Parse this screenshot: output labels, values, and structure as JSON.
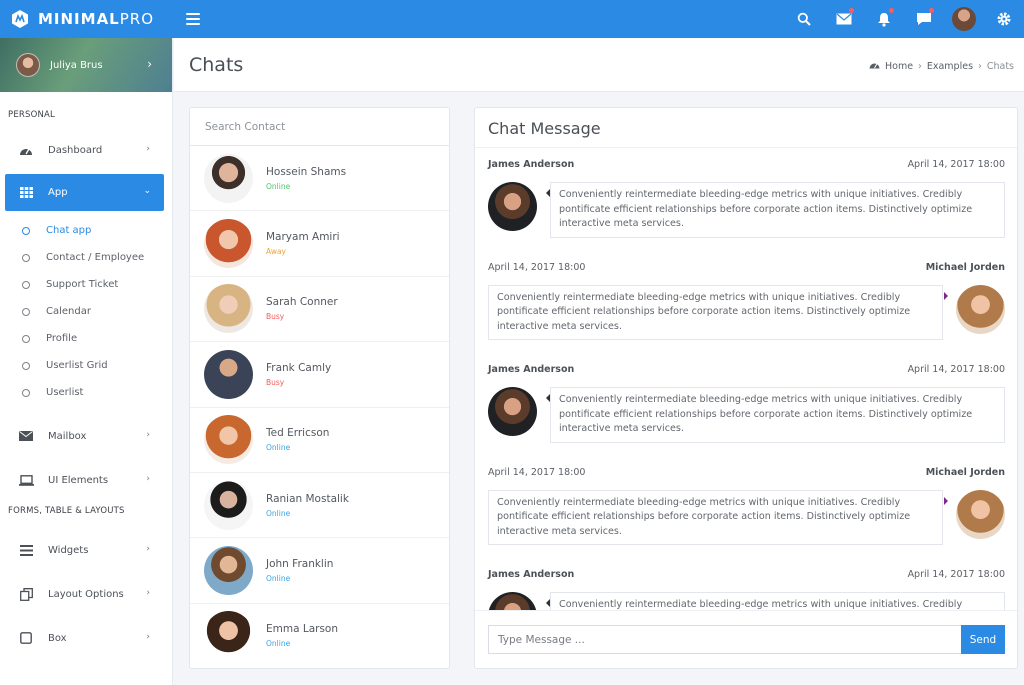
{
  "brand": {
    "name": "MINIMAL",
    "suffix": "PRO"
  },
  "topbar": {
    "icons": [
      "search-icon",
      "mail-icon",
      "bell-icon",
      "chat-icon",
      "avatar",
      "gear-icon"
    ],
    "accent": "#2b8ae3",
    "notification_dot": "#ff5b5b"
  },
  "sidebar": {
    "user": {
      "name": "Juliya Brus"
    },
    "section_personal": "PERSONAL",
    "section_forms": "FORMS, TABLE & LAYOUTS",
    "items": {
      "dashboard": "Dashboard",
      "app": "App",
      "mailbox": "Mailbox",
      "ui_elements": "UI Elements",
      "widgets": "Widgets",
      "layout_options": "Layout Options",
      "box": "Box"
    },
    "app_sub": [
      "Chat app",
      "Contact / Employee",
      "Support Ticket",
      "Calendar",
      "Profile",
      "Userlist Grid",
      "Userlist"
    ]
  },
  "header": {
    "title": "Chats",
    "breadcrumb": [
      "Home",
      "Examples",
      "Chats"
    ]
  },
  "contacts": {
    "search_placeholder": "Search Contact",
    "list": [
      {
        "name": "Hossein Shams",
        "status": "Online",
        "color": "#4cc76b"
      },
      {
        "name": "Maryam Amiri",
        "status": "Away",
        "color": "#f1a33a"
      },
      {
        "name": "Sarah Conner",
        "status": "Busy",
        "color": "#f45b5b"
      },
      {
        "name": "Frank Camly",
        "status": "Busy",
        "color": "#f45b5b"
      },
      {
        "name": "Ted Erricson",
        "status": "Online",
        "color": "#3aa4e8"
      },
      {
        "name": "Ranian Mostalik",
        "status": "Online",
        "color": "#3aa4e8"
      },
      {
        "name": "John Franklin",
        "status": "Online",
        "color": "#3aa4e8"
      },
      {
        "name": "Emma Larson",
        "status": "Online",
        "color": "#3aa4e8"
      }
    ]
  },
  "chat": {
    "title": "Chat Message",
    "messages": [
      {
        "name": "James Anderson",
        "time": "April 14, 2017 18:00",
        "text": "Conveniently reintermediate bleeding-edge metrics with unique initiatives. Credibly pontificate efficient relationships before corporate action items. Distinctively optimize interactive meta services."
      },
      {
        "name": "Michael Jorden",
        "time": "April 14, 2017 18:00",
        "text": "Conveniently reintermediate bleeding-edge metrics with unique initiatives. Credibly pontificate efficient relationships before corporate action items. Distinctively optimize interactive meta services."
      },
      {
        "name": "James Anderson",
        "time": "April 14, 2017 18:00",
        "text": "Conveniently reintermediate bleeding-edge metrics with unique initiatives. Credibly pontificate efficient relationships before corporate action items. Distinctively optimize interactive meta services."
      },
      {
        "name": "Michael Jorden",
        "time": "April 14, 2017 18:00",
        "text": "Conveniently reintermediate bleeding-edge metrics with unique initiatives. Credibly pontificate efficient relationships before corporate action items. Distinctively optimize interactive meta services."
      },
      {
        "name": "James Anderson",
        "time": "April 14, 2017 18:00",
        "text": "Conveniently reintermediate bleeding-edge metrics with unique initiatives. Credibly pontificate efficient relationships before corporate action items. Distinctively optimize interactive meta services."
      }
    ],
    "input_placeholder": "Type Message ...",
    "send_label": "Send"
  }
}
